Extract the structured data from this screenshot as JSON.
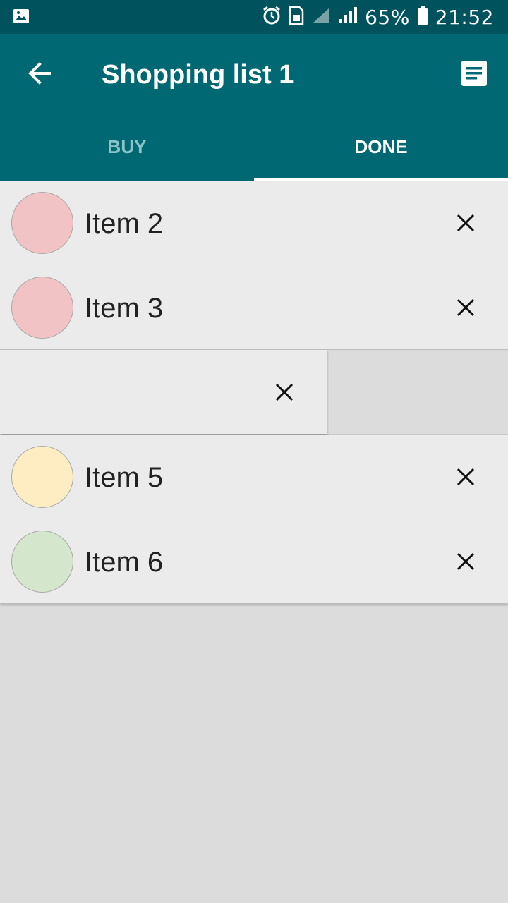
{
  "status_bar": {
    "battery": "65%",
    "time": "21:52",
    "icons": [
      "gallery-icon",
      "alarm-icon",
      "sim-icon",
      "signal-icon",
      "signal-icon",
      "battery-icon"
    ]
  },
  "app_bar": {
    "title": "Shopping list 1",
    "back_icon": "arrow-back-icon",
    "action_icon": "document-icon"
  },
  "tabs": [
    {
      "label": "BUY",
      "selected": false
    },
    {
      "label": "DONE",
      "selected": true
    }
  ],
  "items": [
    {
      "label": "Item 2",
      "color": "#f1c3c4"
    },
    {
      "label": "Item 3",
      "color": "#f1c3c4"
    },
    {
      "label": "",
      "swiped": true
    },
    {
      "label": "Item 5",
      "color": "#feedc3"
    },
    {
      "label": "Item 6",
      "color": "#d4e6cc"
    }
  ],
  "colors": {
    "status_bar": "#00535d",
    "app_bar": "#006872",
    "background": "#dcdcdc",
    "row": "#ebebeb"
  }
}
